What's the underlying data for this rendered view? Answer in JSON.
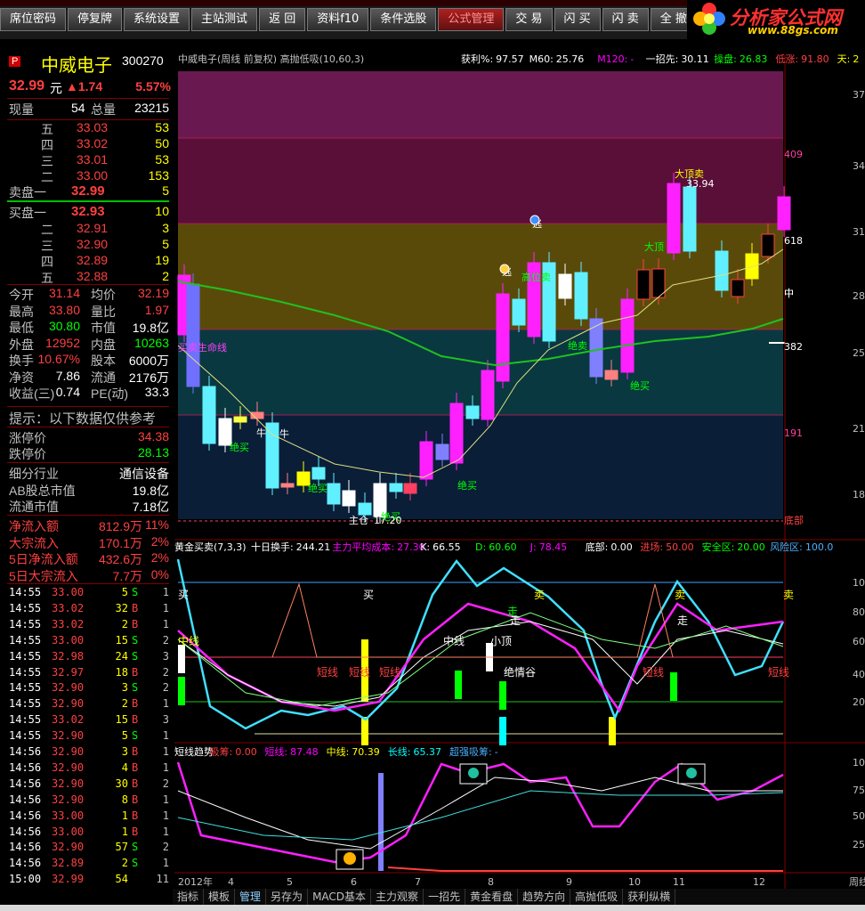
{
  "toolbar": {
    "buttons": [
      "席位密码",
      "停复牌",
      "系统设置",
      "主站测试",
      "返 回",
      "资料f10",
      "条件选股",
      "公式管理",
      "交 易",
      "闪 买",
      "闪 卖",
      "全 撤",
      "机"
    ],
    "active_index": 7
  },
  "logo": {
    "brand": "分析家公式网",
    "site": "www.88gs.com"
  },
  "quote": {
    "badge": "P",
    "name": "中威电子",
    "code": "300270",
    "price": "32.99",
    "price_unit": "元",
    "change": "▲1.74",
    "change_pct": "5.57%",
    "volume_now_label": "现量",
    "volume_now": "54",
    "volume_total_label": "总量",
    "volume_total": "23215",
    "asks": [
      [
        "五",
        "33.03",
        "53"
      ],
      [
        "四",
        "33.02",
        "50"
      ],
      [
        "三",
        "33.01",
        "53"
      ],
      [
        "二",
        "33.00",
        "153"
      ]
    ],
    "ask1_label": "卖盘一",
    "ask1_price": "32.99",
    "ask1_vol": "5",
    "bid1_label": "买盘一",
    "bid1_price": "32.93",
    "bid1_vol": "10",
    "bids": [
      [
        "二",
        "32.91",
        "3"
      ],
      [
        "三",
        "32.90",
        "5"
      ],
      [
        "四",
        "32.89",
        "19"
      ],
      [
        "五",
        "32.88",
        "2"
      ]
    ],
    "stats": [
      [
        "今开",
        "31.14",
        "均价",
        "32.19"
      ],
      [
        "最高",
        "33.80",
        "量比",
        "1.97"
      ],
      [
        "最低",
        "30.80",
        "市值",
        "19.8亿"
      ],
      [
        "外盘",
        "12952",
        "内盘",
        "10263"
      ],
      [
        "换手",
        "10.67%",
        "股本",
        "6000万"
      ],
      [
        "净资",
        "7.86",
        "流通",
        "2176万"
      ],
      [
        "收益(三)",
        "0.74",
        "PE(动)",
        "33.3"
      ]
    ],
    "tip": "提示：以下数据仅供参考",
    "limits": [
      [
        "涨停价",
        "34.38"
      ],
      [
        "跌停价",
        "28.13"
      ]
    ],
    "info": [
      [
        "细分行业",
        "通信设备"
      ],
      [
        "AB股总市值",
        "19.8亿"
      ],
      [
        "流通市值",
        "7.18亿"
      ]
    ],
    "flows": [
      [
        "净流入额",
        "812.9万",
        "11%"
      ],
      [
        "大宗流入",
        "170.1万",
        "2%"
      ],
      [
        "5日净流入额",
        "432.6万",
        "2%"
      ],
      [
        "5日大宗流入",
        "7.7万",
        "0%"
      ]
    ],
    "ticks": [
      [
        "14:55",
        "33.00",
        "5",
        "S",
        "1"
      ],
      [
        "14:55",
        "33.02",
        "32",
        "B",
        "1"
      ],
      [
        "14:55",
        "33.02",
        "2",
        "B",
        "1"
      ],
      [
        "14:55",
        "33.00",
        "15",
        "S",
        "2"
      ],
      [
        "14:55",
        "32.98",
        "24",
        "S",
        "3"
      ],
      [
        "14:55",
        "32.97",
        "18",
        "B",
        "2"
      ],
      [
        "14:55",
        "32.90",
        "3",
        "S",
        "2"
      ],
      [
        "14:55",
        "32.90",
        "2",
        "B",
        "1"
      ],
      [
        "14:55",
        "33.02",
        "15",
        "B",
        "3"
      ],
      [
        "14:55",
        "32.90",
        "5",
        "S",
        "1"
      ],
      [
        "14:56",
        "32.90",
        "3",
        "B",
        "1"
      ],
      [
        "14:56",
        "32.90",
        "4",
        "B",
        "1"
      ],
      [
        "14:56",
        "32.90",
        "30",
        "B",
        "2"
      ],
      [
        "14:56",
        "32.90",
        "8",
        "B",
        "1"
      ],
      [
        "14:56",
        "33.00",
        "1",
        "B",
        "1"
      ],
      [
        "14:56",
        "33.00",
        "1",
        "B",
        "1"
      ],
      [
        "14:56",
        "32.90",
        "57",
        "S",
        "2"
      ],
      [
        "14:56",
        "32.89",
        "2",
        "S",
        "1"
      ],
      [
        "15:00",
        "32.99",
        "54",
        "",
        "11"
      ]
    ]
  },
  "main_chart": {
    "title": "中威电子(周线 前复权) 高抛低吸(10,60,3)",
    "stats": [
      {
        "label": "获利%:",
        "value": "97.57",
        "color": "#ffffff"
      },
      {
        "label": "M60:",
        "value": "25.76",
        "color": "#ffffff"
      },
      {
        "label": "M120:",
        "value": "-",
        "color": "#ff00ff"
      },
      {
        "label": "一招先:",
        "value": "30.11",
        "color": "#ffffff"
      },
      {
        "label": "操盘:",
        "value": "26.83",
        "color": "#00ff00"
      },
      {
        "label": "低涨:",
        "value": "91.80",
        "color": "#ff4040"
      },
      {
        "label": "天:",
        "value": "2",
        "color": "#ffff00"
      }
    ],
    "y_ticks": [
      "37",
      "34",
      "31",
      "28",
      "25",
      "21",
      "18"
    ],
    "zone_labels": [
      "409",
      "618",
      "中",
      "382",
      "191",
      "底部"
    ],
    "annotations": [
      "大顶卖",
      "33.94",
      "逃",
      "逃",
      "高位卖",
      "大顶",
      "绝卖",
      "绝买",
      "绝买",
      "中",
      "牛",
      "牛",
      "绝买",
      "绝买",
      "绝买",
      "主仓",
      "17.20",
      "买卖生命线"
    ]
  },
  "mid_chart": {
    "title": "黄金买卖(7,3,3)",
    "stats": [
      {
        "label": "十日换手:",
        "value": "244.21",
        "color": "#ffffff"
      },
      {
        "label": "主力平均成本:",
        "value": "27.30",
        "color": "#ff00ff"
      },
      {
        "label": "K:",
        "value": "66.55",
        "color": "#ffffff"
      },
      {
        "label": "D:",
        "value": "60.60",
        "color": "#00ff00"
      },
      {
        "label": "J:",
        "value": "78.45",
        "color": "#ff00ff"
      },
      {
        "label": "底部:",
        "value": "0.00",
        "color": "#ffffff"
      },
      {
        "label": "进场:",
        "value": "50.00",
        "color": "#ff4040"
      },
      {
        "label": "安全区:",
        "value": "20.00",
        "color": "#00ff00"
      },
      {
        "label": "风险区:",
        "value": "100.0",
        "color": "#4ab0ff"
      }
    ],
    "y_ticks": [
      "100",
      "80",
      "60",
      "40",
      "20"
    ],
    "annotations": [
      "买",
      "买",
      "卖",
      "卖",
      "卖",
      "走",
      "走",
      "中线",
      "中线",
      "小顶",
      "绝情谷",
      "短线",
      "短线",
      "短线",
      "短线",
      "短线",
      "走"
    ]
  },
  "low_chart": {
    "stats": [
      {
        "label": "短线趋势",
        "value": "",
        "color": "#ffffff"
      },
      {
        "label": "吸筹:",
        "value": "0.00",
        "color": "#ff4040"
      },
      {
        "label": "短线:",
        "value": "87.48",
        "color": "#ff00ff"
      },
      {
        "label": "中线:",
        "value": "70.39",
        "color": "#ffff00"
      },
      {
        "label": "长线:",
        "value": "65.37",
        "color": "#00ffff"
      },
      {
        "label": "超强吸筹:",
        "value": "-",
        "color": "#4ab0ff"
      }
    ],
    "y_ticks": [
      "100",
      "75",
      "50",
      "25"
    ],
    "x_ticks": [
      "2012年",
      "4",
      "5",
      "6",
      "7",
      "8",
      "9",
      "10",
      "11",
      "12"
    ],
    "corner": "周线"
  },
  "tabs": [
    "指标",
    "模板",
    "管理",
    "另存为",
    "MACD基本",
    "主力观察",
    "一招先",
    "黄金看盘",
    "趋势方向",
    "高抛低吸",
    "获利纵横"
  ],
  "active_tab": 2,
  "colors": {
    "up": "#ff4040",
    "down": "#00ffff",
    "neutral": "#ffffff",
    "label": "#c0c0c0",
    "accent": "#ffff00"
  }
}
